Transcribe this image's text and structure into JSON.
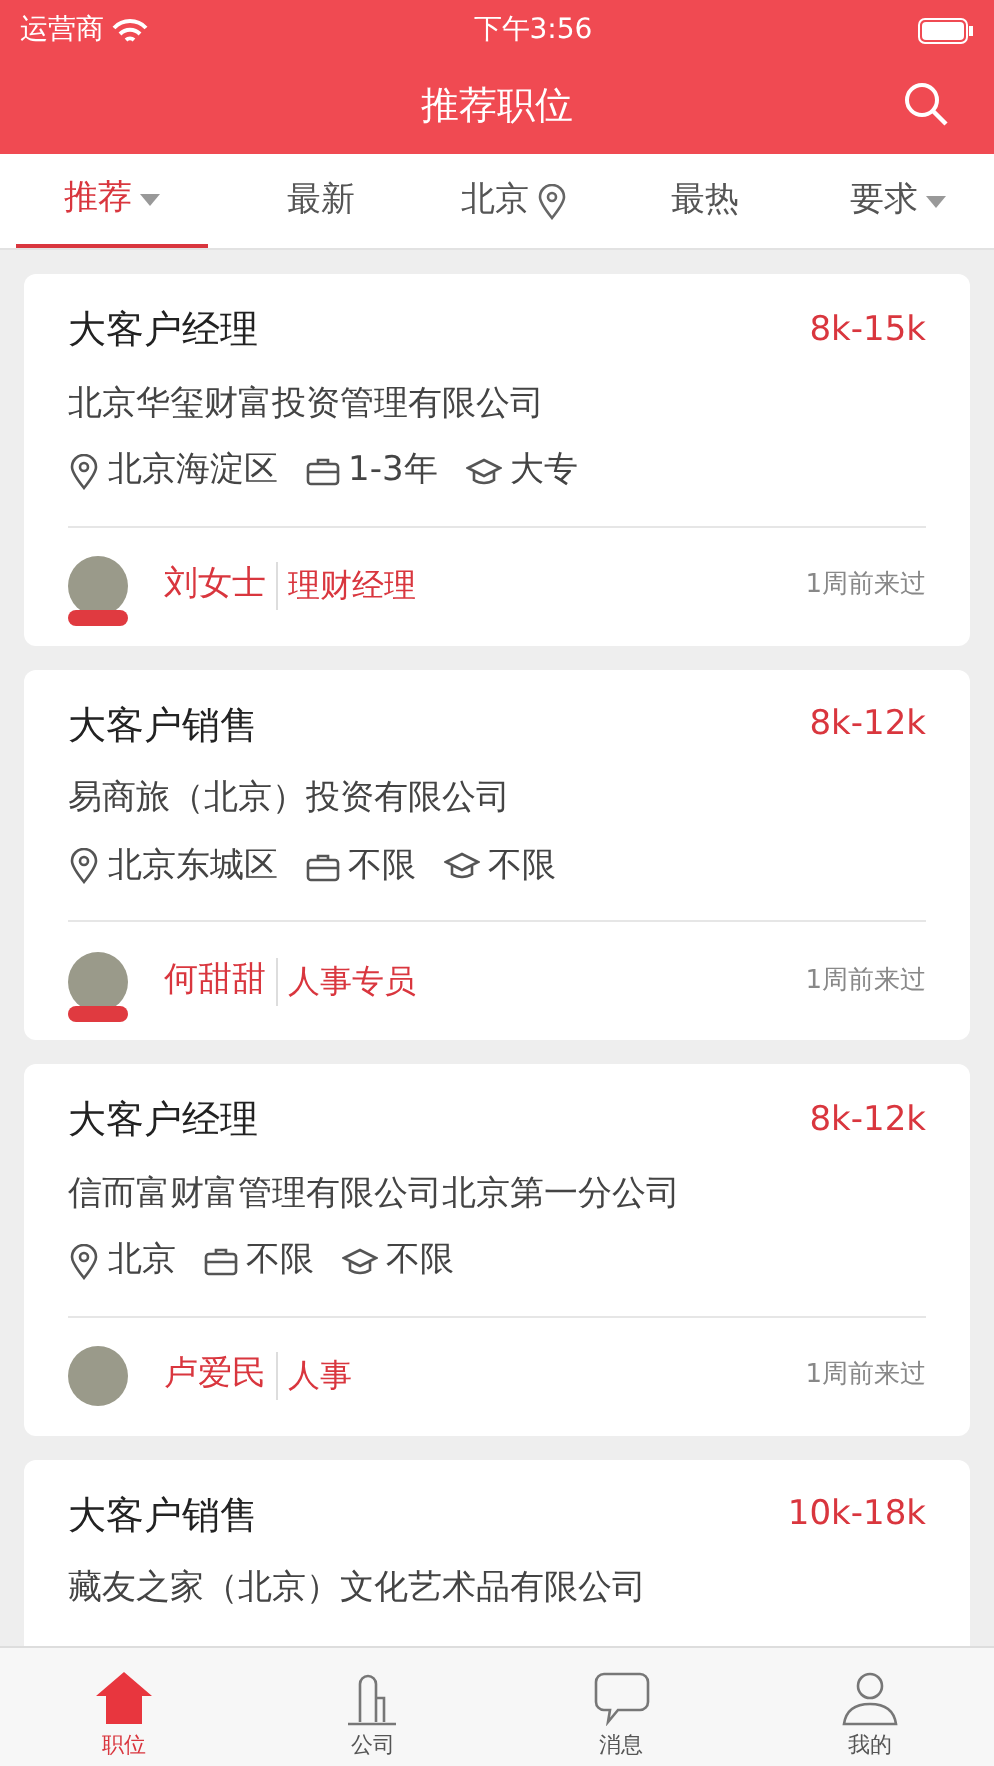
{
  "status_bar": {
    "carrier": "运营商",
    "time": "下午3:56"
  },
  "header": {
    "title": "推荐职位"
  },
  "filter_tabs": [
    {
      "label": "推荐",
      "selected": true,
      "kind": "dropdown"
    },
    {
      "label": "最新",
      "selected": false,
      "kind": "plain"
    },
    {
      "label": "北京",
      "selected": false,
      "kind": "location"
    },
    {
      "label": "最热",
      "selected": false,
      "kind": "plain"
    },
    {
      "label": "要求",
      "selected": false,
      "kind": "dropdown"
    }
  ],
  "jobs": [
    {
      "title": "大客户经理",
      "salary": "8k-15k",
      "company": "北京华玺财富投资管理有限公司",
      "location": "北京海淀区",
      "experience": "1-3年",
      "education": "大专",
      "recruiter": "刘女士",
      "role": "理财经理",
      "last_seen": "1周前来过",
      "verified": true
    },
    {
      "title": "大客户销售",
      "salary": "8k-12k",
      "company": "易商旅（北京）投资有限公司",
      "location": "北京东城区",
      "experience": "不限",
      "education": "不限",
      "recruiter": "何甜甜",
      "role": "人事专员",
      "last_seen": "1周前来过",
      "verified": true
    },
    {
      "title": "大客户经理",
      "salary": "8k-12k",
      "company": "信而富财富管理有限公司北京第一分公司",
      "location": "北京",
      "experience": "不限",
      "education": "不限",
      "recruiter": "卢爱民",
      "role": "人事",
      "last_seen": "1周前来过",
      "verified": false
    },
    {
      "title": "大客户销售",
      "salary": "10k-18k",
      "company": "藏友之家（北京）文化艺术品有限公司"
    }
  ],
  "tab_bar": [
    {
      "label": "职位",
      "selected": true,
      "kind": "home"
    },
    {
      "label": "公司",
      "selected": false,
      "kind": "company"
    },
    {
      "label": "消息",
      "selected": false,
      "kind": "message"
    },
    {
      "label": "我的",
      "selected": false,
      "kind": "profile"
    }
  ]
}
